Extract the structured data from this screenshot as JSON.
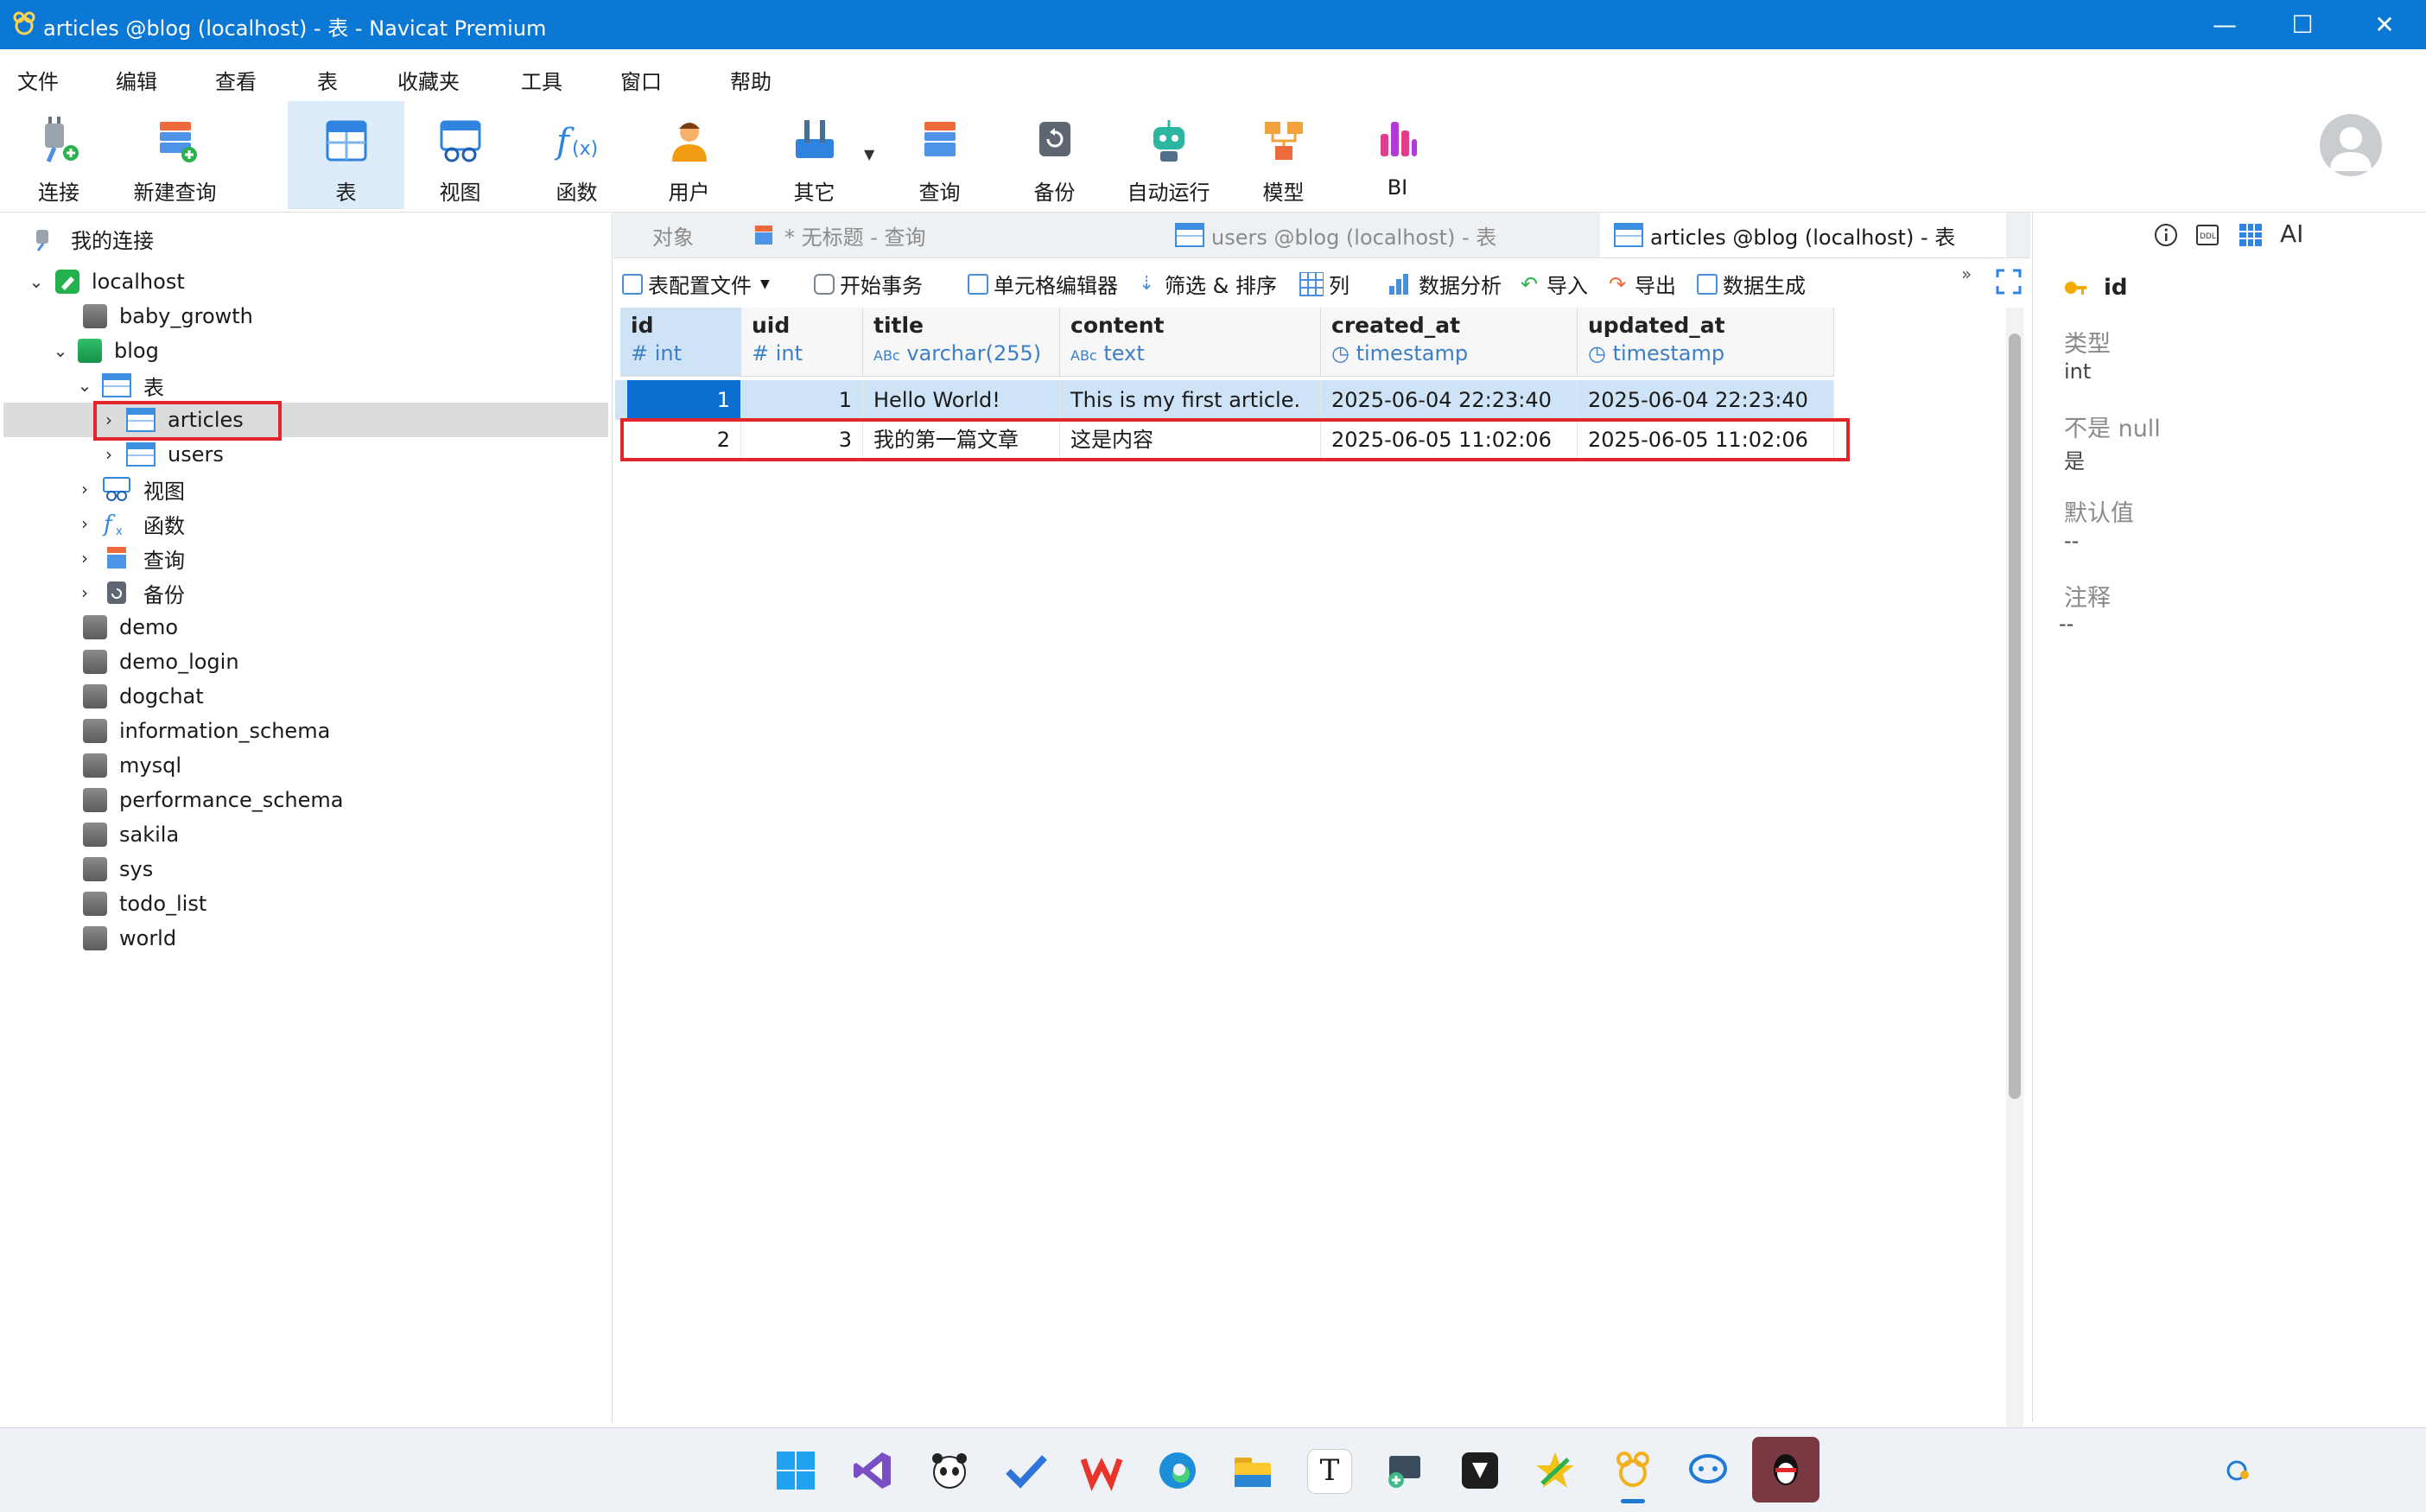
{
  "window": {
    "title": "articles @blog (localhost) - 表 - Navicat Premium",
    "minimize": "—",
    "maximize": "☐",
    "close": "✕"
  },
  "menu": [
    "文件",
    "编辑",
    "查看",
    "表",
    "收藏夹",
    "工具",
    "窗口",
    "帮助"
  ],
  "toolbar": {
    "connect": "连接",
    "new_query": "新建查询",
    "table": "表",
    "view": "视图",
    "function": "函数",
    "user": "用户",
    "other": "其它",
    "query": "查询",
    "backup": "备份",
    "automation": "自动运行",
    "model": "模型",
    "bi": "BI"
  },
  "left_panel": {
    "my_connections": "我的连接",
    "connection": "localhost",
    "databases_before": [
      "baby_growth"
    ],
    "open_db": "blog",
    "tables_node": "表",
    "tables": [
      "articles",
      "users"
    ],
    "blog_children": [
      "视图",
      "函数",
      "查询",
      "备份"
    ],
    "databases_after": [
      "demo",
      "demo_login",
      "dogchat",
      "information_schema",
      "mysql",
      "performance_schema",
      "sakila",
      "sys",
      "todo_list",
      "world"
    ]
  },
  "tabs": {
    "objects": "对象",
    "untitled_query": "* 无标题 - 查询",
    "users_tab": "users @blog (localhost) - 表",
    "articles_tab": "articles @blog (localhost) - 表",
    "overflow": "»"
  },
  "subtoolbar": {
    "table_profile": "表配置文件",
    "begin_transaction": "开始事务",
    "cell_editor": "单元格编辑器",
    "filter_sort": "筛选 & 排序",
    "columns": "列",
    "data_analysis": "数据分析",
    "import": "导入",
    "export": "导出",
    "data_generation": "数据生成"
  },
  "grid": {
    "columns": [
      {
        "name": "id",
        "type": "int",
        "type_icon": "#"
      },
      {
        "name": "uid",
        "type": "int",
        "type_icon": "#"
      },
      {
        "name": "title",
        "type": "varchar(255)",
        "type_icon": "ABc"
      },
      {
        "name": "content",
        "type": "text",
        "type_icon": "ABc"
      },
      {
        "name": "created_at",
        "type": "timestamp",
        "type_icon": "◷"
      },
      {
        "name": "updated_at",
        "type": "timestamp",
        "type_icon": "◷"
      }
    ],
    "rows": [
      [
        "1",
        "1",
        "Hello World!",
        "This is my first article.",
        "2025-06-04 22:23:40",
        "2025-06-04 22:23:40"
      ],
      [
        "2",
        "3",
        "我的第一篇文章",
        "这是内容",
        "2025-06-05 11:02:06",
        "2025-06-05 11:02:06"
      ]
    ]
  },
  "right_panel": {
    "field_name": "id",
    "type_label": "类型",
    "type_value": "int",
    "not_null_label": "不是 null",
    "not_null_value": "是",
    "default_label": "默认值",
    "default_value": "--",
    "comment_label": "注释",
    "comment_value": "--",
    "icons": [
      "info-icon",
      "ddl-icon",
      "grid-icon",
      "ai-icon"
    ],
    "ai_text": "AI"
  },
  "colors": {
    "titlebar": "#0a78d4",
    "selection": "#cfe3f7",
    "selected_cell": "#0b6fd1",
    "highlight_box": "#e0262b"
  }
}
